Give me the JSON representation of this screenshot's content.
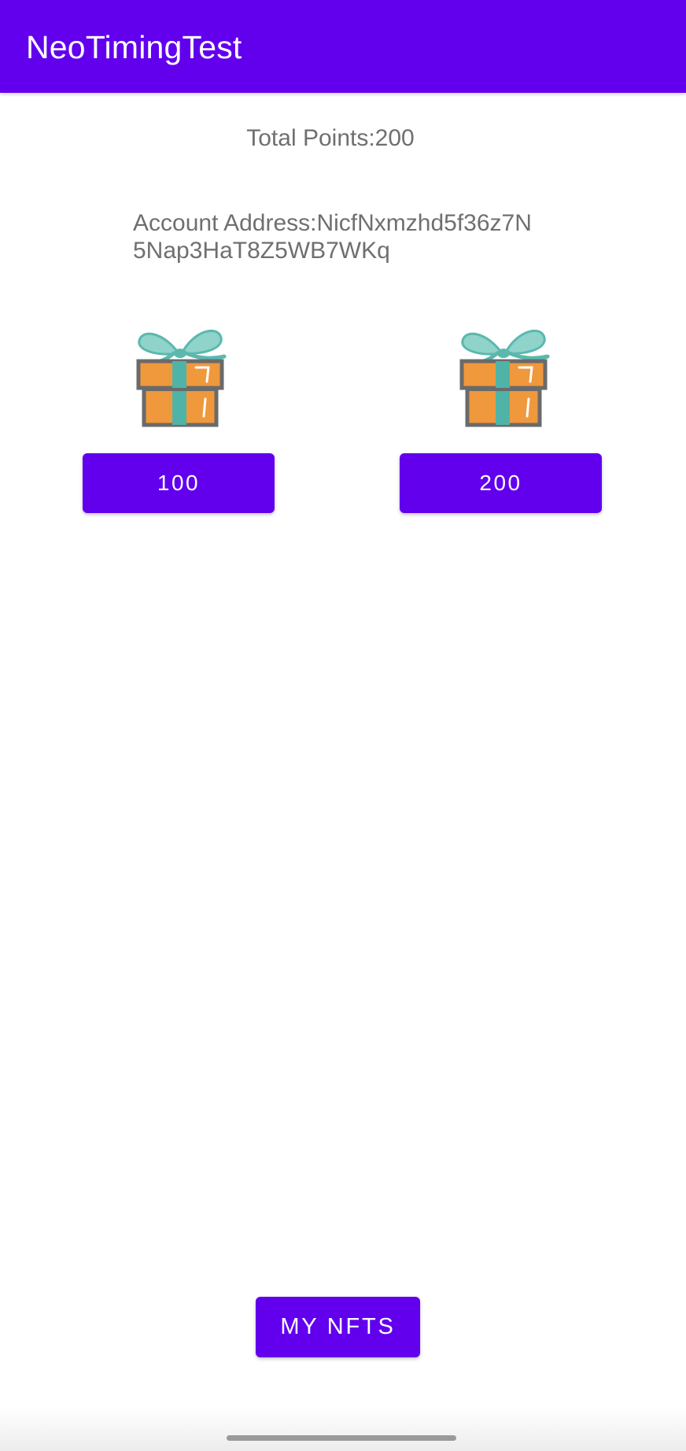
{
  "colors": {
    "primary": "#6200ee",
    "text_secondary": "#6f6f6f",
    "on_primary": "#ffffff"
  },
  "app_bar": {
    "title": "NeoTimingTest"
  },
  "summary": {
    "total_points": "Total Points:200",
    "account_address": "Account Address:NicfNxmzhd5f36z7N5Nap3HaT8Z5WB7WKq"
  },
  "gifts": [
    {
      "icon": "gift-box-icon",
      "button_label": "100"
    },
    {
      "icon": "gift-box-icon",
      "button_label": "200"
    }
  ],
  "footer": {
    "my_nfts_label": "MY NFTS"
  }
}
